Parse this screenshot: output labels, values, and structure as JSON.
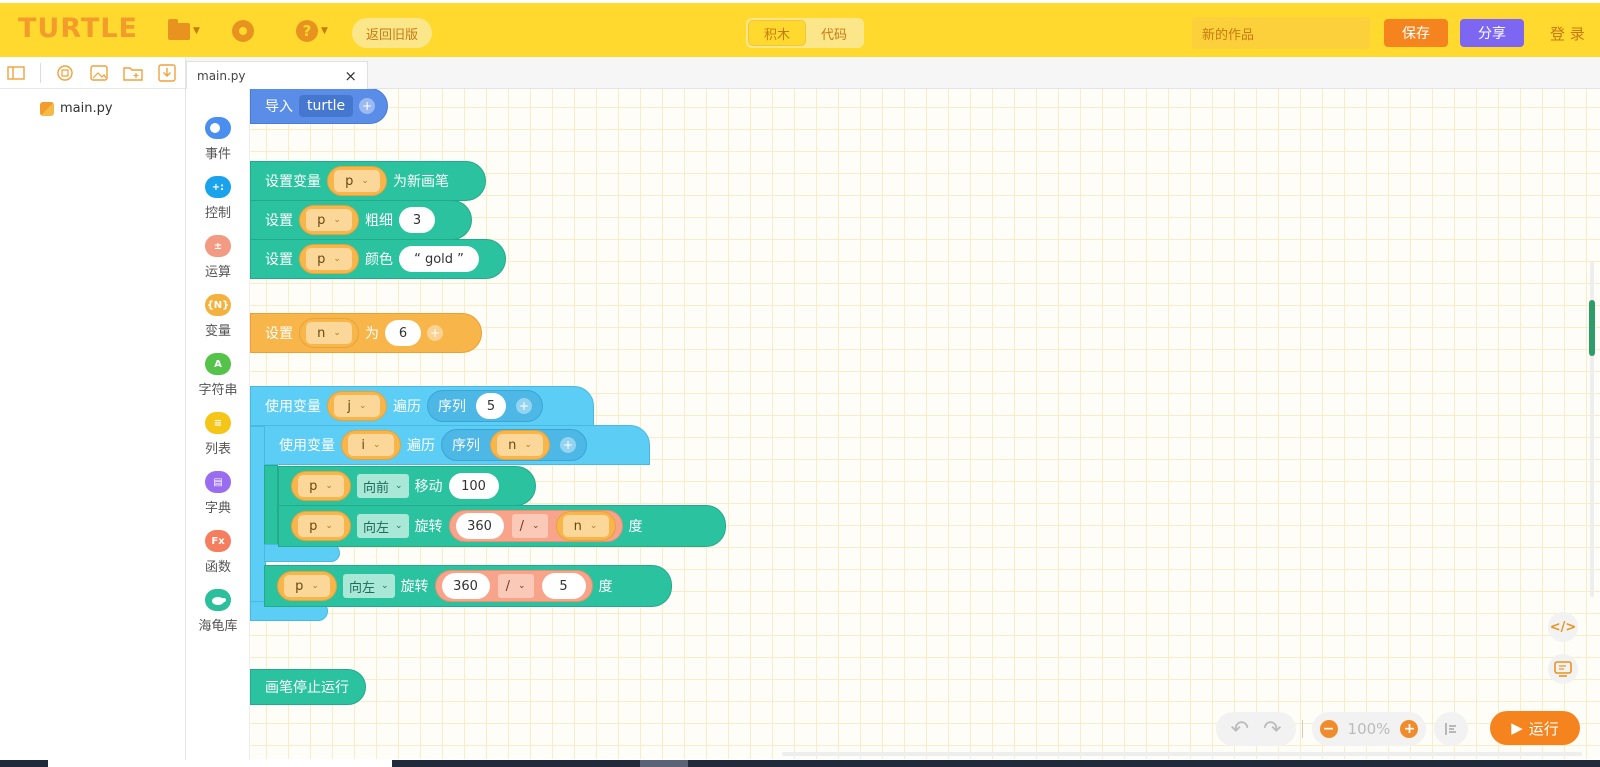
{
  "app": {
    "logo": "TURTLE",
    "back_label": "返回旧版",
    "mode_tabs": [
      "积木",
      "代码"
    ],
    "active_mode": "积木",
    "title_placeholder": "新的作品",
    "save_label": "保存",
    "share_label": "分享",
    "login_label": "登 录"
  },
  "files": {
    "items": [
      "main.py"
    ]
  },
  "editor": {
    "tab_label": "main.py",
    "tab_close": "×"
  },
  "palette": [
    {
      "label": "事件",
      "color": "#4a8ef0",
      "glyph": ""
    },
    {
      "label": "控制",
      "color": "#1aa3ec",
      "glyph": "+:"
    },
    {
      "label": "运算",
      "color": "#f39a82",
      "glyph": "±"
    },
    {
      "label": "变量",
      "color": "#f5b13d",
      "glyph": "{N}"
    },
    {
      "label": "字符串",
      "color": "#55c24a",
      "glyph": "A"
    },
    {
      "label": "列表",
      "color": "#f5c518",
      "glyph": "≡"
    },
    {
      "label": "字典",
      "color": "#9a6cf0",
      "glyph": "▤"
    },
    {
      "label": "函数",
      "color": "#f47e5e",
      "glyph": "Fx"
    },
    {
      "label": "海龟库",
      "color": "#2bbf9c",
      "glyph": "🐢"
    }
  ],
  "blocks": {
    "import": {
      "label": "导入",
      "module": "turtle",
      "plus": "+"
    },
    "set_pen": {
      "label": "设置变量",
      "var": "p",
      "suffix": "为新画笔"
    },
    "set_width": {
      "label": "设置",
      "var": "p",
      "prop": "粗细",
      "value": "3"
    },
    "set_color": {
      "label": "设置",
      "var": "p",
      "prop": "颜色",
      "value": "“ gold ”"
    },
    "set_n": {
      "label": "设置",
      "var": "n",
      "mid": "为",
      "value": "6",
      "plus": "+"
    },
    "loop_j": {
      "label": "使用变量",
      "var": "j",
      "mid": "遍历",
      "seq_label": "序列",
      "seq_value": "5",
      "plus": "+"
    },
    "loop_i": {
      "label": "使用变量",
      "var": "i",
      "mid": "遍历",
      "seq_label": "序列",
      "seq_var": "n",
      "plus": "+"
    },
    "move": {
      "var": "p",
      "direction": "向前",
      "action": "移动",
      "value": "100"
    },
    "turn_inner": {
      "var": "p",
      "direction": "向左",
      "action": "旋转",
      "num": "360",
      "op": "/",
      "divisor": "n",
      "unit": "度"
    },
    "turn_outer": {
      "var": "p",
      "direction": "向左",
      "action": "旋转",
      "num": "360",
      "op": "/",
      "divisor": "5",
      "unit": "度"
    },
    "stop": {
      "label": "画笔停止运行"
    }
  },
  "controls": {
    "zoom": "100%",
    "zoom_out": "−",
    "zoom_in": "+",
    "run_label": "运行",
    "code_toggle": "</>"
  }
}
